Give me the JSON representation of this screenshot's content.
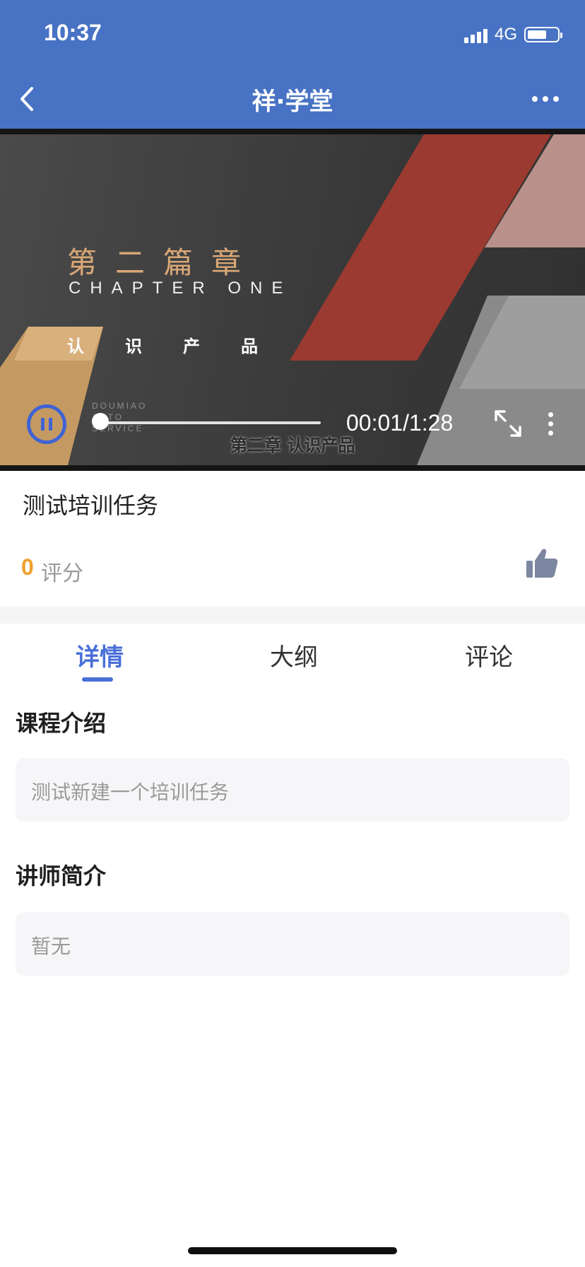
{
  "status_bar": {
    "time": "10:37",
    "network": "4G",
    "battery_level": 0.68
  },
  "nav": {
    "title": "祥·学堂",
    "back_icon": "chevron-left-icon",
    "more_icon": "more-horizontal-icon"
  },
  "video": {
    "slide": {
      "chapter_cn": "第二篇章",
      "chapter_en": "CHAPTER ONE",
      "subtitle_cn": "认识产品",
      "brand_line1": "DOUMIAO",
      "brand_line2": "AUTO",
      "brand_line3": "SERVICE"
    },
    "caption": "第二章 认识产品",
    "time_display": "00:01/1:28",
    "progress": 0.013,
    "state": "playing",
    "accent_color": "#3f63d4"
  },
  "course": {
    "title": "测试培训任务",
    "rating_value": "0",
    "rating_label": "评分",
    "like_icon": "thumbs-up-icon"
  },
  "tabs": [
    {
      "label": "详情",
      "active": true
    },
    {
      "label": "大纲",
      "active": false
    },
    {
      "label": "评论",
      "active": false
    }
  ],
  "details": {
    "intro_heading": "课程介绍",
    "intro_text": "测试新建一个培训任务",
    "teacher_heading": "讲师简介",
    "teacher_text": "暂无"
  },
  "colors": {
    "header_bg": "#4873c4",
    "tab_active": "#4a6fd8",
    "rating": "#f0a02c"
  }
}
